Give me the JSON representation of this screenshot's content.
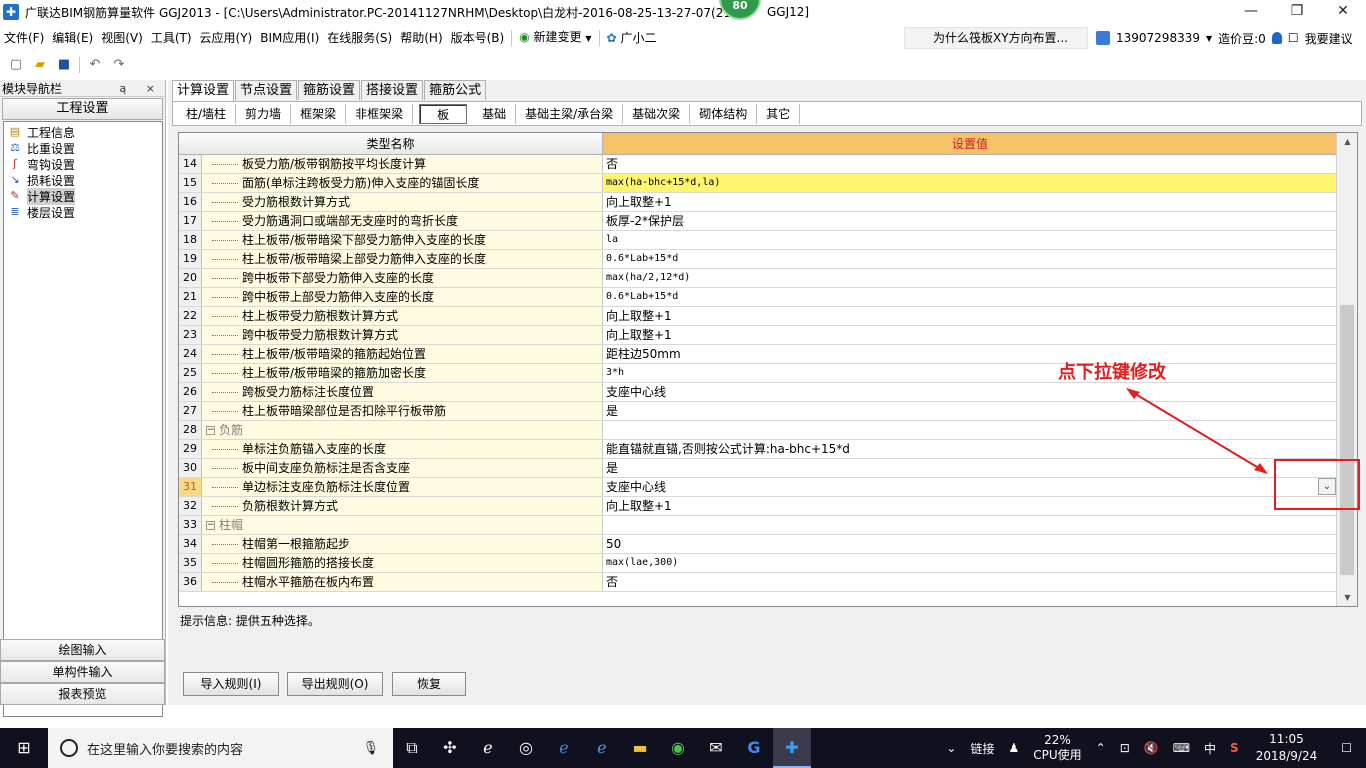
{
  "window": {
    "title": "广联达BIM钢筋算量软件 GGJ2013 - [C:\\Users\\Administrator.PC-20141127NRHM\\Desktop\\白龙村-2016-08-25-13-27-07(21",
    "title_tail": "GGJ12]",
    "badge": "80",
    "minimize": "—",
    "maximize": "❐",
    "close": "✕"
  },
  "menu": {
    "items": [
      "文件(F)",
      "编辑(E)",
      "视图(V)",
      "工具(T)",
      "云应用(Y)",
      "BIM应用(I)",
      "在线服务(S)",
      "帮助(H)",
      "版本号(B)"
    ],
    "new_change": "新建变更",
    "assistant": "广小二",
    "hint": "为什么筏板XY方向布置...",
    "phone": "13907298339",
    "beans": "造价豆:0",
    "suggest": "我要建议"
  },
  "toolbar": {
    "icons": [
      "new-file-icon",
      "open-folder-icon",
      "save-icon",
      "undo-icon",
      "redo-icon"
    ]
  },
  "nav": {
    "title": "模块导航栏",
    "pin": "ą ×",
    "section": "工程设置",
    "tree": [
      {
        "label": "工程信息",
        "icon": "info-icon"
      },
      {
        "label": "比重设置",
        "icon": "weight-icon"
      },
      {
        "label": "弯钩设置",
        "icon": "hook-icon"
      },
      {
        "label": "损耗设置",
        "icon": "loss-icon"
      },
      {
        "label": "计算设置",
        "icon": "calc-icon",
        "selected": true
      },
      {
        "label": "楼层设置",
        "icon": "floor-icon"
      }
    ],
    "bottom": [
      "绘图输入",
      "单构件输入",
      "报表预览"
    ]
  },
  "tabs": [
    "计算设置",
    "节点设置",
    "箍筋设置",
    "搭接设置",
    "箍筋公式"
  ],
  "subtabs": [
    "柱/墙柱",
    "剪力墙",
    "框架梁",
    "非框架梁",
    "板",
    "基础",
    "基础主梁/承台梁",
    "基础次梁",
    "砌体结构",
    "其它"
  ],
  "grid": {
    "col_name": "类型名称",
    "col_value": "设置值",
    "rows": [
      {
        "n": "14",
        "name": "板受力筋/板带钢筋按平均长度计算",
        "value": "否"
      },
      {
        "n": "15",
        "name": "面筋(单标注跨板受力筋)伸入支座的锚固长度",
        "value": "max(ha-bhc+15*d,la)",
        "mono": true,
        "highlight": true
      },
      {
        "n": "16",
        "name": "受力筋根数计算方式",
        "value": "向上取整+1"
      },
      {
        "n": "17",
        "name": "受力筋遇洞口或端部无支座时的弯折长度",
        "value": "板厚-2*保护层"
      },
      {
        "n": "18",
        "name": "柱上板带/板带暗梁下部受力筋伸入支座的长度",
        "value": "la",
        "mono": true
      },
      {
        "n": "19",
        "name": "柱上板带/板带暗梁上部受力筋伸入支座的长度",
        "value": "0.6*Lab+15*d",
        "mono": true
      },
      {
        "n": "20",
        "name": "跨中板带下部受力筋伸入支座的长度",
        "value": "max(ha/2,12*d)",
        "mono": true
      },
      {
        "n": "21",
        "name": "跨中板带上部受力筋伸入支座的长度",
        "value": "0.6*Lab+15*d",
        "mono": true
      },
      {
        "n": "22",
        "name": "柱上板带受力筋根数计算方式",
        "value": "向上取整+1"
      },
      {
        "n": "23",
        "name": "跨中板带受力筋根数计算方式",
        "value": "向上取整+1"
      },
      {
        "n": "24",
        "name": "柱上板带/板带暗梁的箍筋起始位置",
        "value": "距柱边50mm"
      },
      {
        "n": "25",
        "name": "柱上板带/板带暗梁的箍筋加密长度",
        "value": "3*h",
        "mono": true
      },
      {
        "n": "26",
        "name": "跨板受力筋标注长度位置",
        "value": "支座中心线"
      },
      {
        "n": "27",
        "name": "柱上板带暗梁部位是否扣除平行板带筋",
        "value": "是"
      },
      {
        "n": "28",
        "name": "负筋",
        "value": "",
        "group": true
      },
      {
        "n": "29",
        "name": "单标注负筋锚入支座的长度",
        "value": "能直锚就直锚,否则按公式计算:ha-bhc+15*d"
      },
      {
        "n": "30",
        "name": "板中间支座负筋标注是否含支座",
        "value": "是"
      },
      {
        "n": "31",
        "name": "单边标注支座负筋标注长度位置",
        "value": "支座中心线",
        "current": true,
        "dropdown": true
      },
      {
        "n": "32",
        "name": "负筋根数计算方式",
        "value": "向上取整+1"
      },
      {
        "n": "33",
        "name": "柱帽",
        "value": "",
        "group": true
      },
      {
        "n": "34",
        "name": "柱帽第一根箍筋起步",
        "value": "50"
      },
      {
        "n": "35",
        "name": "柱帽圆形箍筋的搭接长度",
        "value": "max(lae,300)",
        "mono": true
      },
      {
        "n": "36",
        "name": "柱帽水平箍筋在板内布置",
        "value": "否"
      }
    ]
  },
  "tip": "提示信息: 提供五种选择。",
  "buttons": {
    "import": "导入规则(I)",
    "export": "导出规则(O)",
    "restore": "恢复"
  },
  "annotation": {
    "text": "点下拉键修改",
    "color": "#e31e1e"
  },
  "taskbar": {
    "search_placeholder": "在这里输入你要搜索的内容",
    "link": "链接",
    "cpu_percent": "22%",
    "cpu_label": "CPU使用",
    "ime": "中",
    "time": "11:05",
    "date": "2018/9/24"
  }
}
